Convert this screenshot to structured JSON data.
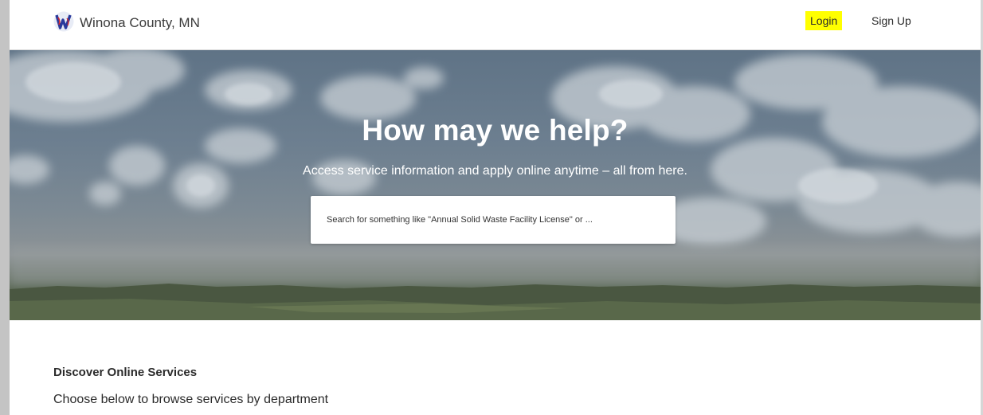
{
  "header": {
    "site_name": "Winona County, MN",
    "logo_icon": "winona-county-w-logo",
    "login_label": "Login",
    "signup_label": "Sign Up",
    "login_highlight_color": "#ffff00"
  },
  "hero": {
    "title": "How may we help?",
    "subtitle": "Access service information and apply online anytime – all from here.",
    "search": {
      "placeholder": "Search for something like \"Annual Solid Waste Facility License\" or ...",
      "value": ""
    }
  },
  "services": {
    "title": "Discover Online Services",
    "subtitle": "Choose below to browse services by department"
  }
}
